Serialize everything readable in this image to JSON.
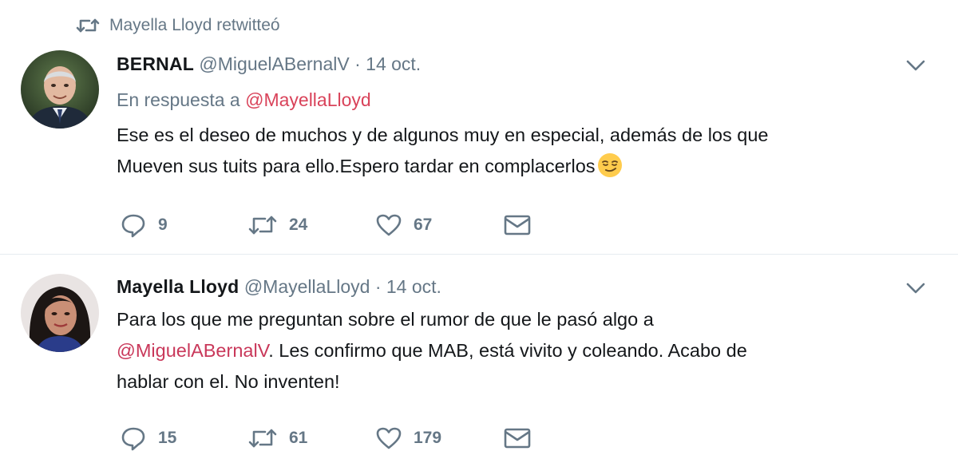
{
  "tweets": [
    {
      "retweet_context": "Mayella Lloyd retwitteó",
      "fullname": "BERNAL",
      "handle": "@MiguelABernalV",
      "separator": "·",
      "time": "14 oct.",
      "reply_prefix": "En respuesta a",
      "reply_handle": "@MayellaLloyd",
      "text_line1": "Ese es el deseo de muchos y de algunos muy en especial, además de los que",
      "text_line2": "Mueven sus tuits para ello.Espero tardar en complacerlos",
      "emoji": "smirking-face-emoji",
      "replies": "9",
      "retweets": "24",
      "likes": "67"
    },
    {
      "fullname": "Mayella Lloyd",
      "handle": "@MayellaLloyd",
      "separator": "·",
      "time": "14 oct.",
      "text_line1": "Para los que me preguntan sobre el rumor de que le pasó algo a",
      "mention": "@MiguelABernalV",
      "text_line2_rest": ". Les confirmo que MAB, está vivito y coleando. Acabo de",
      "text_line3": "hablar con el. No inventen!",
      "replies": "15",
      "retweets": "61",
      "likes": "179"
    }
  ],
  "colors": {
    "secondary": "#657786",
    "text": "#14171a",
    "mention": "#c9385a",
    "divider": "#e6ecf0"
  }
}
